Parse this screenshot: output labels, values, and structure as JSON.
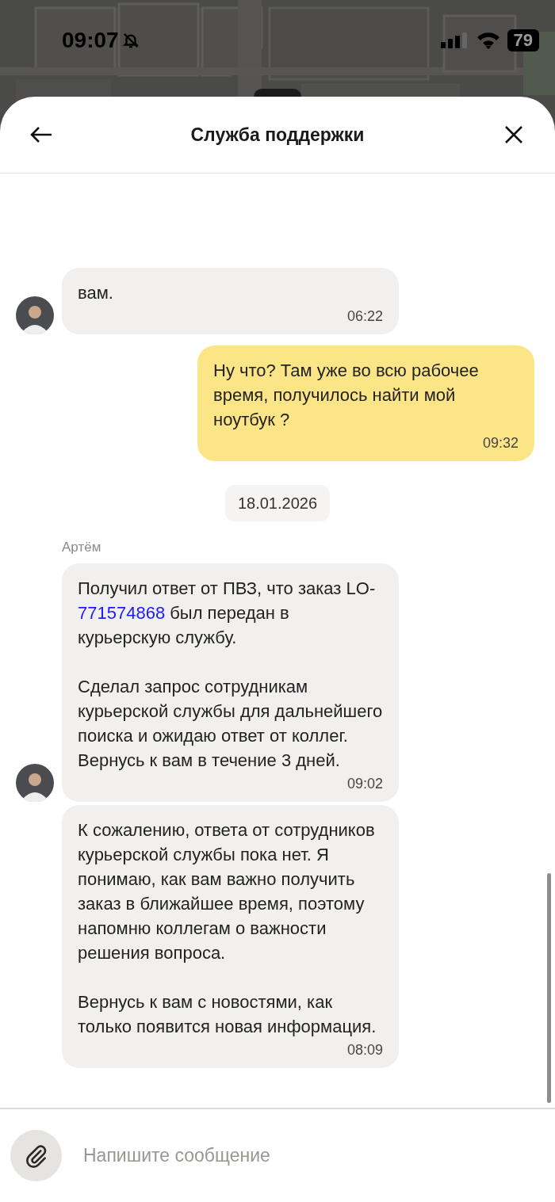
{
  "status_bar": {
    "time": "09:07",
    "battery": "79"
  },
  "header": {
    "title": "Служба поддержки"
  },
  "messages": [
    {
      "kind": "incoming",
      "avatar": true,
      "paragraphs": [
        [
          {
            "text": "вам."
          }
        ]
      ],
      "time": "06:22"
    },
    {
      "kind": "outgoing",
      "paragraphs": [
        [
          {
            "text": "Ну что? Там уже во всю рабочее время, получилось найти мой ноутбук ?"
          }
        ]
      ],
      "time": "09:32"
    },
    {
      "kind": "date",
      "text": "18.01.2026"
    },
    {
      "kind": "incoming",
      "sender": "Артём",
      "avatar": true,
      "paragraphs": [
        [
          {
            "text": "Получил ответ от ПВЗ, что заказ LO-"
          },
          {
            "text": "771574868",
            "link": true
          },
          {
            "text": " был передан в курьерскую службу."
          }
        ],
        [
          {
            "text": "Сделал запрос сотрудникам курьерской службы для дальнейшего поиска и ожидаю ответ от коллег. Вернусь к вам в течение 3 дней."
          }
        ]
      ],
      "time": "09:02"
    },
    {
      "kind": "incoming",
      "avatar": false,
      "paragraphs": [
        [
          {
            "text": "К сожалению, ответа от сотрудников курьерской службы пока нет. Я понимаю, как вам важно получить заказ в ближайшее время, поэтому напомню коллегам о важности решения вопроса."
          }
        ],
        [
          {
            "text": "Вернусь к вам с новостями, как только появится новая информация."
          }
        ]
      ],
      "time": "08:09"
    }
  ],
  "composer": {
    "placeholder": "Напишите сообщение"
  }
}
